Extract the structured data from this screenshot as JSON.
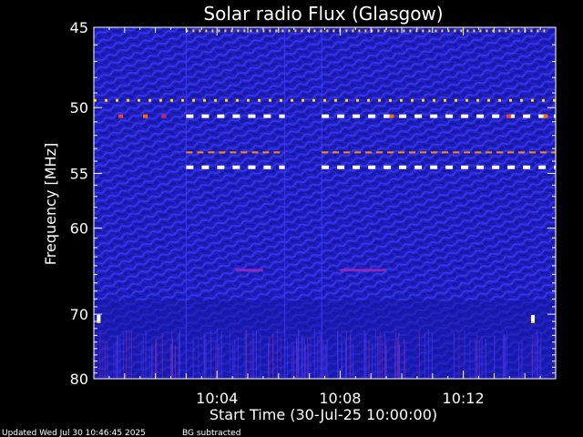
{
  "chart_data": {
    "type": "heatmap",
    "title": "Solar radio Flux (Glasgow)",
    "xlabel": "Start Time (30-Jul-25 10:00:00)",
    "ylabel": "Frequency [MHz]",
    "y_axis": {
      "ticks": [
        45,
        50,
        55,
        60,
        70,
        80
      ],
      "tick_labels": [
        "45",
        "50",
        "55",
        "60",
        "70",
        "80"
      ],
      "ylim": [
        45,
        80
      ],
      "inverted": true,
      "scale": "reciprocal"
    },
    "x_axis": {
      "xlim_minutes": [
        0,
        15
      ],
      "ticks_minutes": [
        4,
        8,
        12
      ],
      "tick_labels": [
        "10:04",
        "10:08",
        "10:12"
      ]
    },
    "colormap": [
      "#1a1aa8",
      "#2b2bea",
      "#6a2bd8",
      "#c8286a",
      "#ff6a00",
      "#ffd800",
      "#ffffff"
    ],
    "background_color": "#1c1cb4",
    "features": [
      {
        "kind": "interference",
        "freq_mhz": 49.5,
        "t_start_min": 0.0,
        "t_end_min": 15.0,
        "intensity": "high"
      },
      {
        "kind": "interference",
        "freq_mhz": 50.6,
        "t_start_min": 3.0,
        "t_end_min": 6.2,
        "intensity": "max"
      },
      {
        "kind": "interference",
        "freq_mhz": 50.6,
        "t_start_min": 7.4,
        "t_end_min": 15.0,
        "intensity": "max"
      },
      {
        "kind": "interference",
        "freq_mhz": 53.3,
        "t_start_min": 3.0,
        "t_end_min": 6.2,
        "intensity": "medium"
      },
      {
        "kind": "interference",
        "freq_mhz": 53.3,
        "t_start_min": 7.4,
        "t_end_min": 15.0,
        "intensity": "medium"
      },
      {
        "kind": "interference",
        "freq_mhz": 54.5,
        "t_start_min": 3.0,
        "t_end_min": 6.2,
        "intensity": "max"
      },
      {
        "kind": "interference",
        "freq_mhz": 54.5,
        "t_start_min": 7.4,
        "t_end_min": 15.0,
        "intensity": "max"
      },
      {
        "kind": "interference",
        "freq_mhz": 45.2,
        "t_start_min": 3.0,
        "t_end_min": 14.8,
        "intensity": "high"
      },
      {
        "kind": "enhancement",
        "freq_mhz": 64.5,
        "t_start_min": 4.6,
        "t_end_min": 5.5,
        "intensity": "low"
      },
      {
        "kind": "enhancement",
        "freq_mhz": 64.5,
        "t_start_min": 8.0,
        "t_end_min": 9.5,
        "intensity": "low"
      },
      {
        "kind": "spot",
        "freq_mhz": 70.6,
        "t_start_min": 0.1,
        "t_end_min": 0.2,
        "intensity": "max"
      },
      {
        "kind": "spot",
        "freq_mhz": 70.6,
        "t_start_min": 14.2,
        "t_end_min": 14.3,
        "intensity": "max"
      }
    ]
  },
  "footer": {
    "updated": "Updated Wed Jul 30 10:46:45 2025",
    "note": "BG subtracted"
  }
}
